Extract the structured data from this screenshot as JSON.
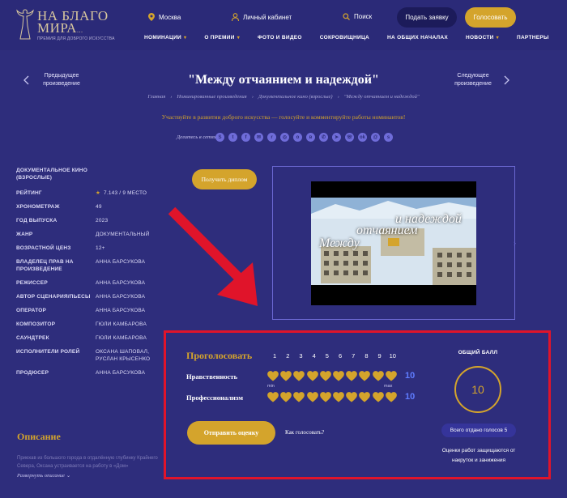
{
  "header": {
    "logo_line1": "НА БЛАГО",
    "logo_line2": "МИРА",
    "logo_dots": "...",
    "logo_sub": "ПРЕМИЯ ДЛЯ ДОБРОГО ИСКУССТВА",
    "city": "Москва",
    "cabinet": "Личный кабинет",
    "search": "Поиск",
    "submit_button": "Подать заявку",
    "vote_button": "Голосовать"
  },
  "nav": [
    {
      "label": "НОМИНАЦИИ",
      "dropdown": true
    },
    {
      "label": "О ПРЕМИИ",
      "dropdown": true
    },
    {
      "label": "ФОТО И ВИДЕО",
      "dropdown": false
    },
    {
      "label": "СОКРОВИЩНИЦА",
      "dropdown": false
    },
    {
      "label": "НА ОБЩИХ НАЧАЛАХ",
      "dropdown": false
    },
    {
      "label": "НОВОСТИ",
      "dropdown": true
    },
    {
      "label": "ПАРТНЕРЫ",
      "dropdown": false
    }
  ],
  "work_nav": {
    "prev_line1": "Предыдущее",
    "prev_line2": "произведение",
    "next_line1": "Следующее",
    "next_line2": "произведение",
    "title": "\"Между отчаянием и надеждой\""
  },
  "breadcrumb": [
    "Главная",
    "Номинированные произведения",
    "Документальное кино (взрослые)",
    "\"Между отчаянием и надеждой\""
  ],
  "tagline": "Участвуйте в развитии доброго искусства — голосуйте и комментируйте работы номинантов!",
  "share": {
    "label": "Делитесь в сетях:",
    "icons": [
      "skype-icon",
      "twitter-icon",
      "facebook-icon",
      "vk-messenger-icon",
      "reddit-icon",
      "myworld-icon",
      "odnoklassniki-icon",
      "vk-icon",
      "whatsapp-icon",
      "telegram-icon",
      "viber-icon",
      "ok-icon",
      "mail-icon",
      "skype-alt-icon"
    ]
  },
  "info": {
    "category": "ДОКУМЕНТАЛЬНОЕ КИНО (ВЗРОСЛЫЕ)",
    "rows": [
      {
        "key": "РЕЙТИНГ",
        "value": "7.143 / 9 МЕСТО",
        "star": true
      },
      {
        "key": "ХРОНОМЕТРАЖ",
        "value": "49"
      },
      {
        "key": "ГОД ВЫПУСКА",
        "value": "2023"
      },
      {
        "key": "ЖАНР",
        "value": "ДОКУМЕНТАЛЬНЫЙ"
      },
      {
        "key": "ВОЗРАСТНОЙ ЦЕНЗ",
        "value": "12+"
      },
      {
        "key": "ВЛАДЕЛЕЦ ПРАВ НА ПРОИЗВЕДЕНИЕ",
        "value": "АННА БАРСУКОВА"
      },
      {
        "key": "РЕЖИССЕР",
        "value": "АННА БАРСУКОВА"
      },
      {
        "key": "АВТОР СЦЕНАРИЯ/ПЬЕСЫ",
        "value": "АННА БАРСУКОВА"
      },
      {
        "key": "ОПЕРАТОР",
        "value": "АННА БАРСУКОВА"
      },
      {
        "key": "КОМПОЗИТОР",
        "value": "ГЮЛИ КАМБАРОВА"
      },
      {
        "key": "САУНДТРЕК",
        "value": "ГЮЛИ КАМБАРОВА"
      },
      {
        "key": "ИСПОЛНИТЕЛИ РОЛЕЙ",
        "value": "ОКСАНА ШАПОВАЛ, РУСЛАН КРЫСЕНКО"
      },
      {
        "key": "ПРОДЮСЕР",
        "value": "АННА БАРСУКОВА"
      }
    ]
  },
  "diploma_button": "Получить диплом",
  "video": {
    "overlay_line1": "и надеждой",
    "overlay_line2": "отчаянием",
    "overlay_line3": "Между"
  },
  "voting": {
    "title": "Проголосовать",
    "scale": [
      "1",
      "2",
      "3",
      "4",
      "5",
      "6",
      "7",
      "8",
      "9",
      "10"
    ],
    "criteria": [
      {
        "label": "Нравственность",
        "score": "10",
        "filled": 10
      },
      {
        "label": "Профессионализм",
        "score": "10",
        "filled": 10
      }
    ],
    "min_label": "min",
    "max_label": "max",
    "send_button": "Отправить оценку",
    "how_link": "Как голосовать?",
    "total_label": "ОБЩИЙ БАЛЛ",
    "total_score": "10",
    "votes_count": "Всего отдано голосов 5",
    "protect_note": "Оценки работ защищаются от накруток и занижения"
  },
  "description": {
    "title": "Описание",
    "text": "Приехав из большого города в отдалённую глубинку Крайнего Севера, Оксана устраивается на работу в «Дом»",
    "more": "Развернуть описание"
  },
  "colors": {
    "background": "#2e2d7c",
    "accent_gold": "#d4a42c",
    "score_blue": "#5f7cff",
    "annotation_red": "#e0142a"
  }
}
